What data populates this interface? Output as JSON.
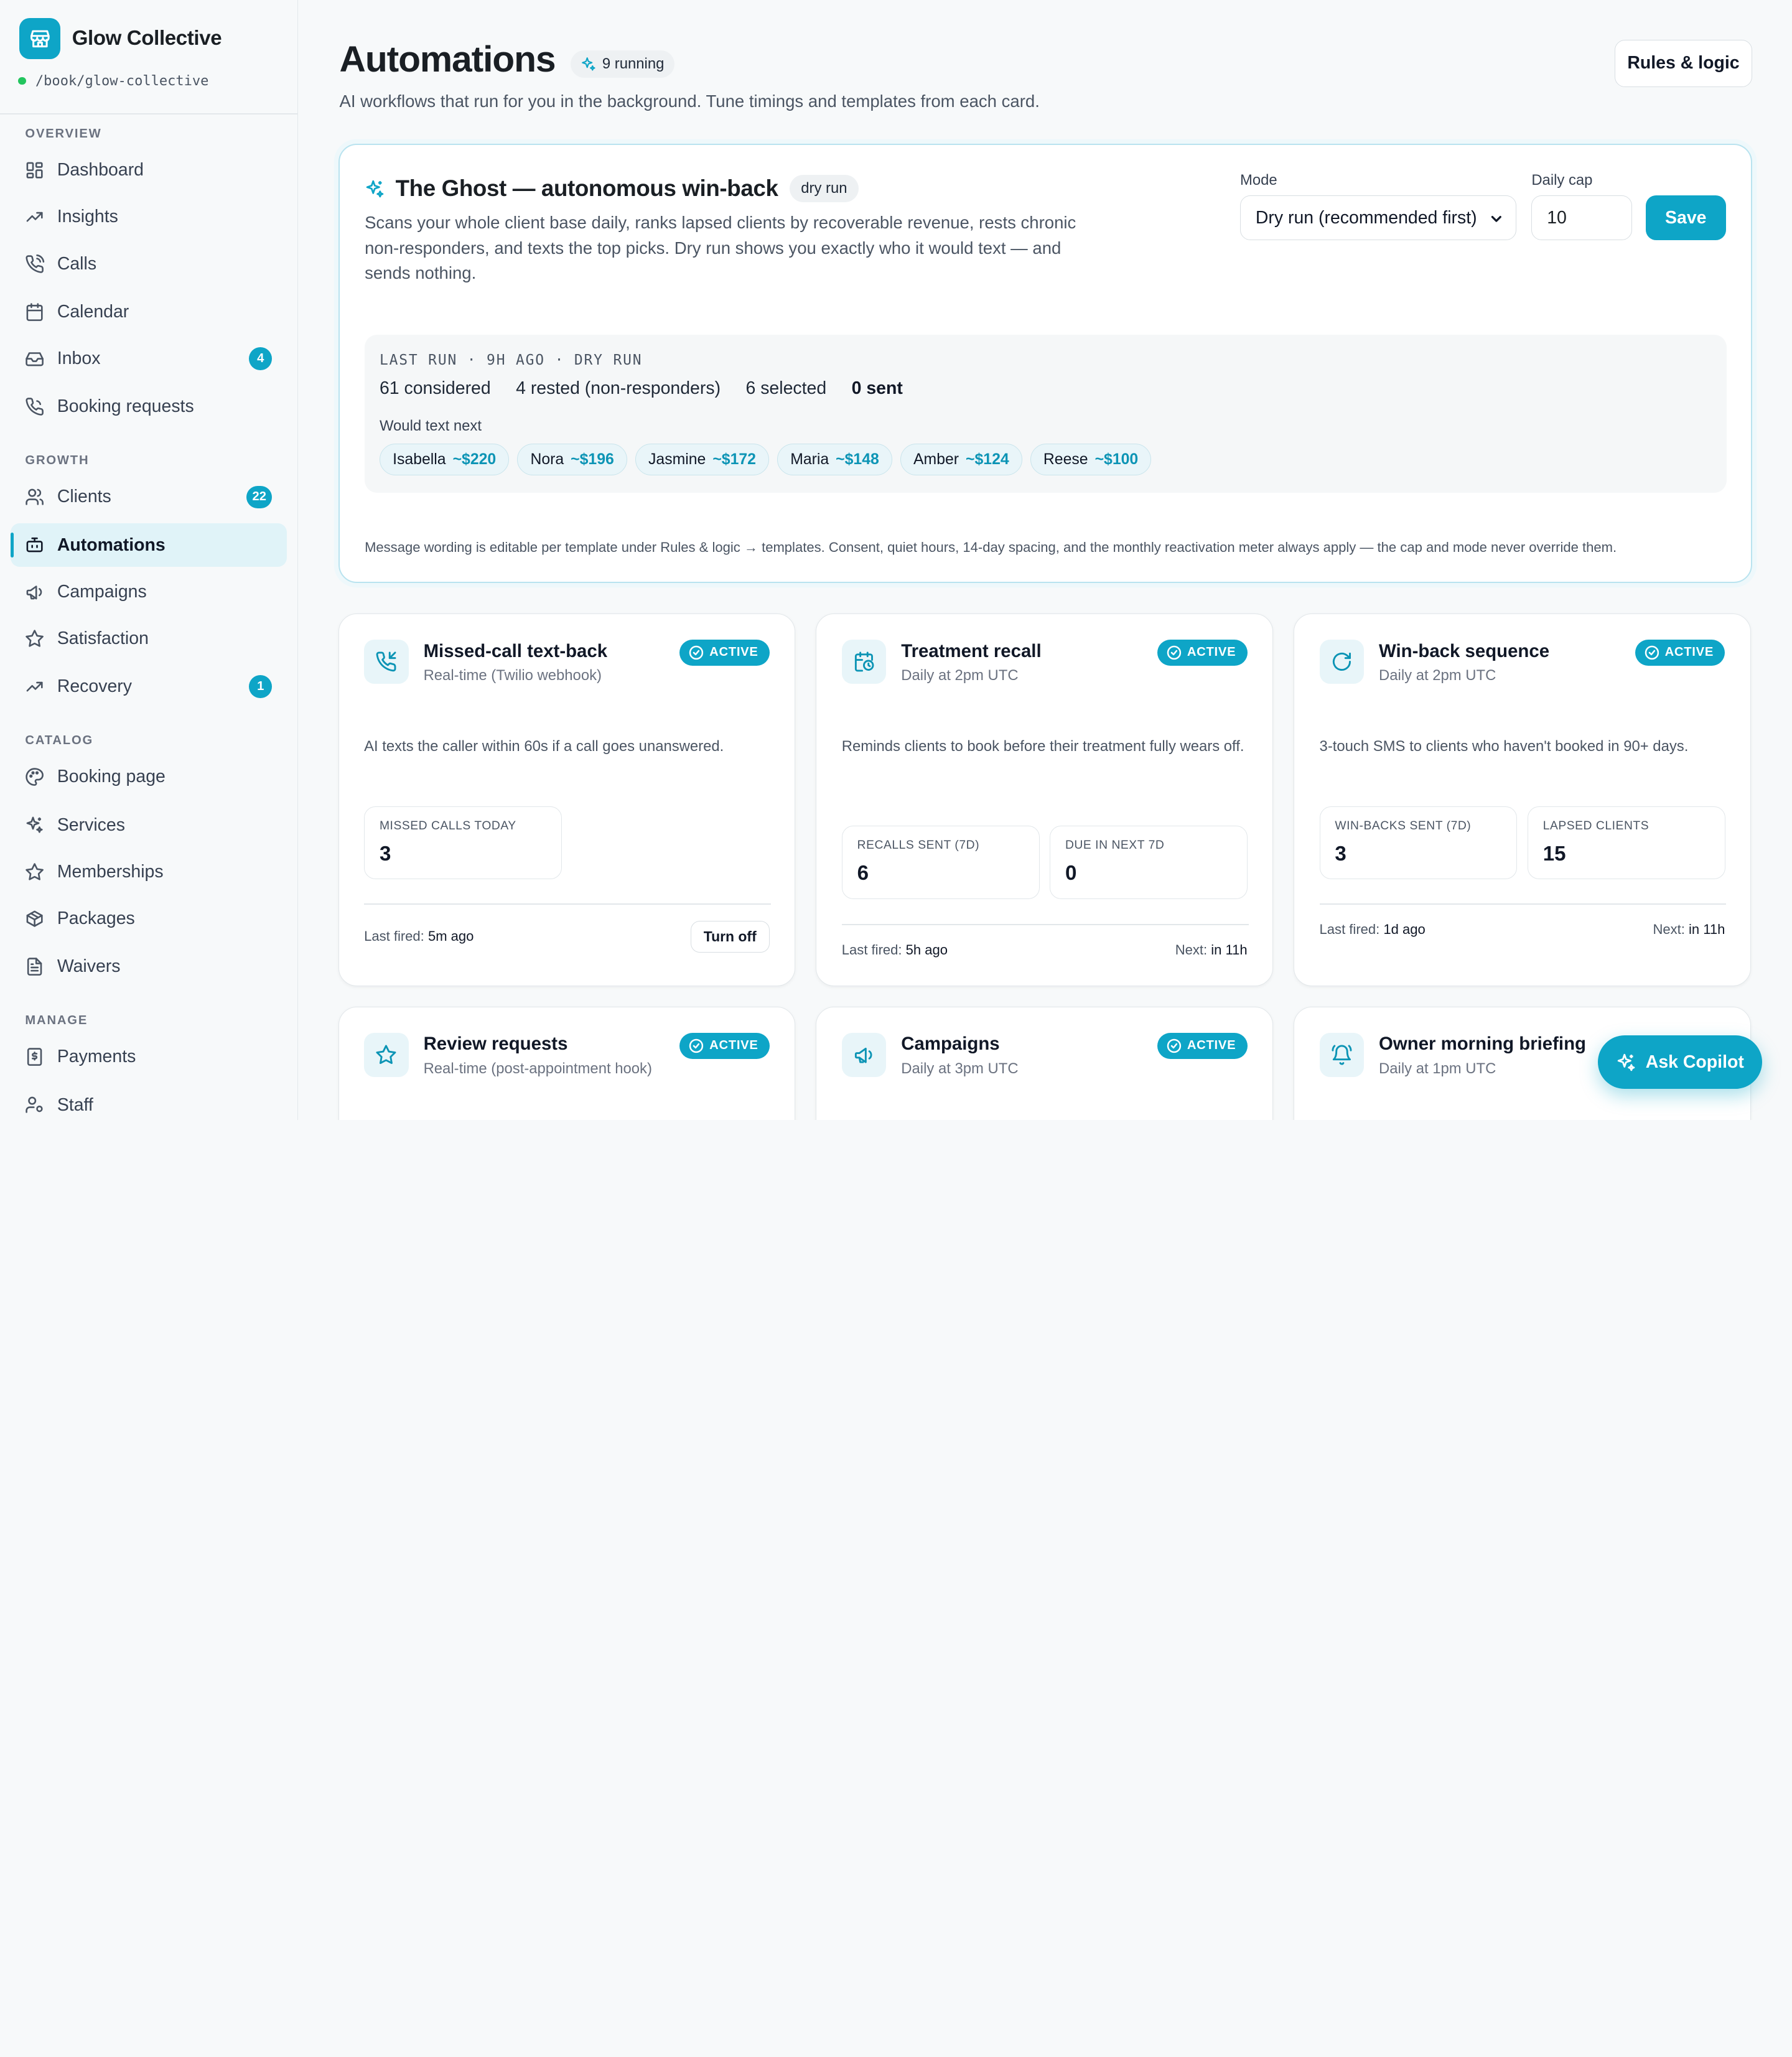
{
  "sidebar": {
    "brand": "Glow Collective",
    "url": "/book/glow-collective",
    "sections": {
      "overview": "OVERVIEW",
      "growth": "GROWTH",
      "catalog": "CATALOG",
      "manage": "MANAGE"
    },
    "items": {
      "dashboard": "Dashboard",
      "insights": "Insights",
      "calls": "Calls",
      "calendar": "Calendar",
      "inbox": "Inbox",
      "inbox_badge": "4",
      "booking_requests": "Booking requests",
      "clients": "Clients",
      "clients_badge": "22",
      "automations": "Automations",
      "campaigns": "Campaigns",
      "satisfaction": "Satisfaction",
      "recovery": "Recovery",
      "recovery_badge": "1",
      "booking_page": "Booking page",
      "services": "Services",
      "memberships": "Memberships",
      "packages": "Packages",
      "waivers": "Waivers",
      "payments": "Payments",
      "staff": "Staff"
    }
  },
  "header": {
    "title": "Automations",
    "running": "9 running",
    "subtitle": "AI workflows that run for you in the background. Tune timings and templates from each card.",
    "rules_button": "Rules & logic"
  },
  "ghost": {
    "title": "The Ghost — autonomous win-back",
    "mode_pill": "dry run",
    "description": "Scans your whole client base daily, ranks lapsed clients by recoverable revenue, rests chronic non-responders, and texts the top picks. Dry run shows you exactly who it would text — and sends nothing.",
    "mode_label": "Mode",
    "mode_value": "Dry run (recommended first)",
    "cap_label": "Daily cap",
    "cap_value": "10",
    "save_label": "Save",
    "last_run_header": "LAST RUN · 9H AGO · DRY RUN",
    "stats": {
      "considered": "61 considered",
      "rested": "4 rested (non-responders)",
      "selected": "6 selected",
      "sent": "0 sent"
    },
    "would_text_label": "Would text next",
    "candidates": [
      {
        "name": "Isabella",
        "amount": "~$220"
      },
      {
        "name": "Nora",
        "amount": "~$196"
      },
      {
        "name": "Jasmine",
        "amount": "~$172"
      },
      {
        "name": "Maria",
        "amount": "~$148"
      },
      {
        "name": "Amber",
        "amount": "~$124"
      },
      {
        "name": "Reese",
        "amount": "~$100"
      }
    ],
    "footnote": "Message wording is editable per template under Rules & logic → templates. Consent, quiet hours, 14-day spacing, and the monthly reactivation meter always apply — the cap and mode never override them."
  },
  "cards": {
    "missed_call": {
      "title": "Missed-call text-back",
      "schedule": "Real-time (Twilio webhook)",
      "status": "ACTIVE",
      "description": "AI texts the caller within 60s if a call goes unanswered.",
      "stat1_label": "MISSED CALLS TODAY",
      "stat1_value": "3",
      "last_label": "Last fired:",
      "last_value": "5m ago",
      "toggle_label": "Turn off"
    },
    "treatment_recall": {
      "title": "Treatment recall",
      "schedule": "Daily at 2pm UTC",
      "status": "ACTIVE",
      "description": "Reminds clients to book before their treatment fully wears off.",
      "stat1_label": "RECALLS SENT (7D)",
      "stat1_value": "6",
      "stat2_label": "DUE IN NEXT 7D",
      "stat2_value": "0",
      "last_label": "Last fired:",
      "last_value": "5h ago",
      "next_label": "Next:",
      "next_value": "in 11h"
    },
    "win_back": {
      "title": "Win-back sequence",
      "schedule": "Daily at 2pm UTC",
      "status": "ACTIVE",
      "description": "3-touch SMS to clients who haven't booked in 90+ days.",
      "stat1_label": "WIN-BACKS SENT (7D)",
      "stat1_value": "3",
      "stat2_label": "LAPSED CLIENTS",
      "stat2_value": "15",
      "last_label": "Last fired:",
      "last_value": "1d ago",
      "next_label": "Next:",
      "next_value": "in 11h"
    },
    "review_requests": {
      "title": "Review requests",
      "schedule": "Real-time (post-appointment hook)",
      "status": "ACTIVE"
    },
    "campaigns": {
      "title": "Campaigns",
      "schedule": "Daily at 3pm UTC",
      "status": "ACTIVE"
    },
    "morning_briefing": {
      "title": "Owner morning briefing",
      "schedule": "Daily at 1pm UTC"
    }
  },
  "copilot": {
    "label": "Ask Copilot"
  },
  "colors": {
    "accent": "#0ea5c7",
    "accent_soft": "#e0f3f8",
    "status_dot": "#22c55e"
  }
}
